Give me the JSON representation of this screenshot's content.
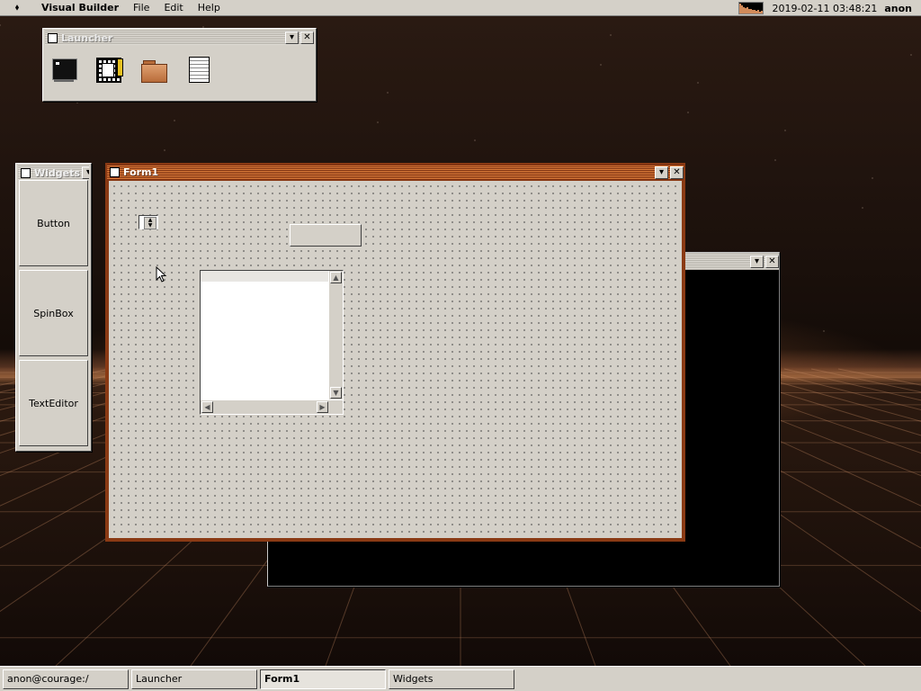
{
  "menubar": {
    "logo": "⬧",
    "app_name": "Visual Builder",
    "menus": [
      "File",
      "Edit",
      "Help"
    ],
    "clock": "2019-02-11 03:48:21",
    "username": "anon",
    "cpu_history": [
      0.9,
      0.75,
      0.55,
      0.5,
      0.6,
      0.45,
      0.4,
      0.35,
      0.3,
      0.25,
      0.3,
      0.2,
      0.25,
      0.2
    ]
  },
  "launcher": {
    "title": "Launcher",
    "apps": [
      "terminal-icon",
      "visual-builder-icon",
      "file-manager-icon",
      "text-editor-icon"
    ]
  },
  "widgets_window": {
    "title": "Widgets",
    "buttons": [
      "Button",
      "SpinBox",
      "TextEditor"
    ]
  },
  "form_window": {
    "title": "Form1"
  },
  "taskbar": {
    "items": [
      {
        "label": "anon@courage:/",
        "active": false
      },
      {
        "label": "Launcher",
        "active": false
      },
      {
        "label": "Form1",
        "active": true
      },
      {
        "label": "Widgets",
        "active": false
      }
    ]
  },
  "colors": {
    "active_title_dark": "#7a2e10",
    "active_title_light": "#e2813c",
    "window_face": "#d4d0c8",
    "terminal_bg": "#000000"
  }
}
